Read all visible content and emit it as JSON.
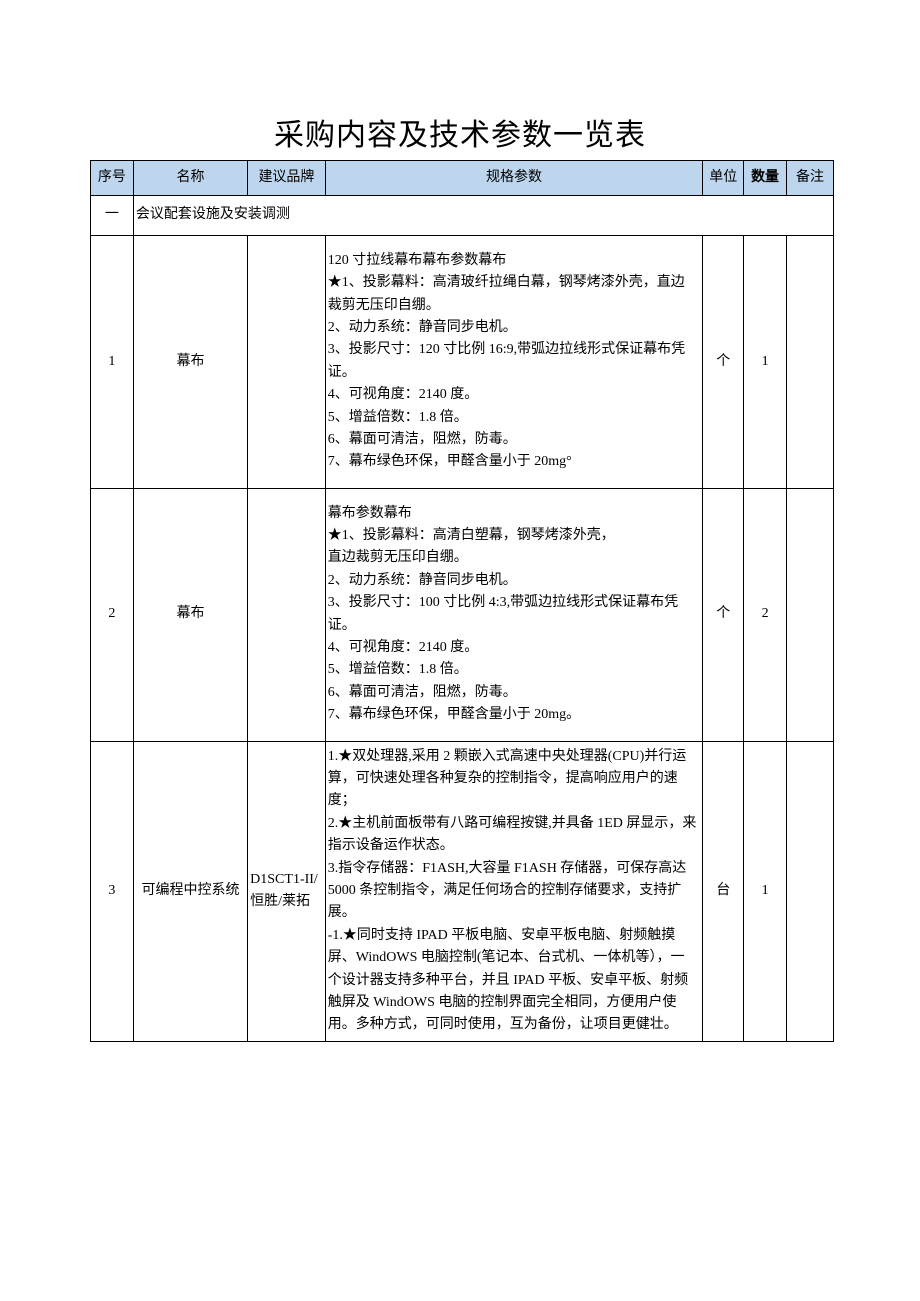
{
  "title": "采购内容及技术参数一览表",
  "headers": {
    "no": "序号",
    "name": "名称",
    "brand": "建议品牌",
    "spec": "规格参数",
    "unit": "单位",
    "qty": "数量",
    "note": "备注"
  },
  "section": {
    "no": "一",
    "title": "会议配套设施及安装调测"
  },
  "rows": [
    {
      "no": "1",
      "name": "幕布",
      "brand": "",
      "spec_lines": [
        "120 寸拉线幕布幕布参数幕布",
        "★1、投影幕料：高清玻纤拉绳白幕，钢琴烤漆外壳，直边裁剪无压印自绷。",
        "2、动力系统：静音同步电机。",
        "3、投影尺寸：120 寸比例 16:9,带弧边拉线形式保证幕布凭证。",
        "4、可视角度：2140 度。",
        "5、增益倍数：1.8 倍。",
        "6、幕面可清洁，阻燃，防毒。",
        "7、幕布绿色环保，甲醛含量小于 20mg°"
      ],
      "unit": "个",
      "qty": "1",
      "note": ""
    },
    {
      "no": "2",
      "name": "幕布",
      "brand": "",
      "spec_lines": [
        "幕布参数幕布",
        "★1、投影幕料：高清白塑幕，钢琴烤漆外壳，",
        "直边裁剪无压印自绷。",
        "2、动力系统：静音同步电机。",
        "3、投影尺寸：100 寸比例 4:3,带弧边拉线形式保证幕布凭证。",
        "4、可视角度：2140 度。",
        "5、增益倍数：1.8 倍。",
        "6、幕面可清洁，阻燃，防毒。",
        "7、幕布绿色环保，甲醛含量小于 20mg。"
      ],
      "unit": "个",
      "qty": "2",
      "note": ""
    },
    {
      "no": "3",
      "name": "可编程中控系统",
      "brand": "D1SCT1-II/恒胜/莱拓",
      "spec_lines": [
        "1.★双处理器,采用 2 颗嵌入式高速中央处理器(CPU)并行运算，可快速处理各种复杂的控制指令，提高响应用户的速度；",
        "2.★主机前面板带有八路可编程按键,并具备 1ED 屏显示，来指示设备运作状态。",
        "3.指令存储器：F1ASH,大容量 F1ASH 存储器，可保存高达 5000 条控制指令，满足任何场合的控制存储要求，支持扩展。",
        "-1.★同时支持 IPAD 平板电脑、安卓平板电脑、射频触摸屏、WindOWS 电脑控制(笔记本、台式机、一体机等），一个设计器支持多种平台，并且 IPAD 平板、安卓平板、射频触屏及 WindOWS 电脑的控制界面完全相同，方便用户使用。多种方式，可同时使用，互为备份，让项目更健壮。"
      ],
      "unit": "台",
      "qty": "1",
      "note": ""
    }
  ]
}
